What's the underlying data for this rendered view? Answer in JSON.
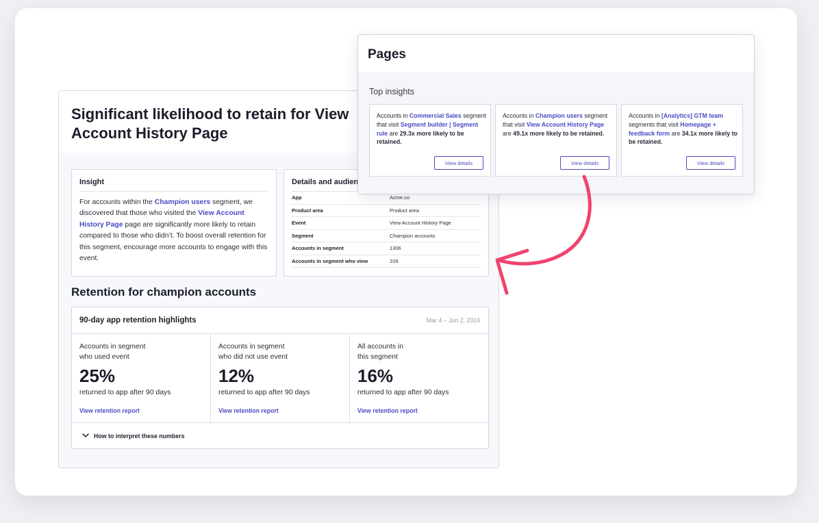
{
  "main": {
    "title": "Significant likelihood to retain for View Account History Page",
    "insight": {
      "heading": "Insight",
      "text_1": "For accounts within the ",
      "link_segment": "Champion users",
      "text_2": " segment, we discovered that those who visited the ",
      "link_page": "View Account History Page",
      "text_3": " page are significantly more likely to retain compared to those who didn’t. To boost overall retention for this segment, encourage more accounts to engage with this event."
    },
    "details": {
      "heading": "Details and audience",
      "rows": [
        {
          "key": "App",
          "value": "Acme.co"
        },
        {
          "key": "Product area",
          "value": "Product area"
        },
        {
          "key": "Event",
          "value": "View Account History Page"
        },
        {
          "key": "Segment",
          "value": "Champion accounts"
        },
        {
          "key": "Accounts in segment",
          "value": "1306"
        },
        {
          "key": "Accounts in segment who view",
          "value": "109"
        }
      ]
    },
    "retention_title": "Retention for champion accounts",
    "retention": {
      "heading": "90-day app retention highlights",
      "date_range": "Mar 4 – Jun 2, 2024",
      "columns": [
        {
          "label_1": "Accounts in segment",
          "label_2": "who used event",
          "pct": "25%",
          "sub": "returned to app after 90 days",
          "link": "View retention report"
        },
        {
          "label_1": "Accounts in segment",
          "label_2": "who did not use event",
          "pct": "12%",
          "sub": "returned to app after 90 days",
          "link": "View retention report"
        },
        {
          "label_1": "All accounts in",
          "label_2": "this segment",
          "pct": "16%",
          "sub": "returned to app after 90 days",
          "link": "View retention report"
        }
      ],
      "footer": "How to interpret these numbers"
    }
  },
  "pages": {
    "title": "Pages",
    "subtitle": "Top insights",
    "cards": [
      {
        "t1": "Accounts in ",
        "seg": "Commercial Sales",
        "t2": " segment that visit ",
        "page": "Segment builder | Segment rule",
        "t3": " are ",
        "mult": "29.3x more likely to be retained.",
        "button": "View details"
      },
      {
        "t1": "Accounts in ",
        "seg": "Champion users",
        "t2": " segment that visit ",
        "page": "View Account History Page",
        "t3": " are ",
        "mult": "49.1x more likely to be retained.",
        "button": "View details"
      },
      {
        "t1": "Accounts in ",
        "seg": "[Analytics] GTM team",
        "t2": " segments that visit ",
        "page": "Homepage + feedback form",
        "t3": " are ",
        "mult": "34.1x more likely to be retained.",
        "button": "View details"
      }
    ]
  },
  "colors": {
    "accent": "#4a4cc4",
    "arrow": "#f0436e",
    "text": "#1b1d2b"
  },
  "icons": {
    "footer_toggle": "chevron-down-icon",
    "annotation": "curved-arrow-icon"
  }
}
